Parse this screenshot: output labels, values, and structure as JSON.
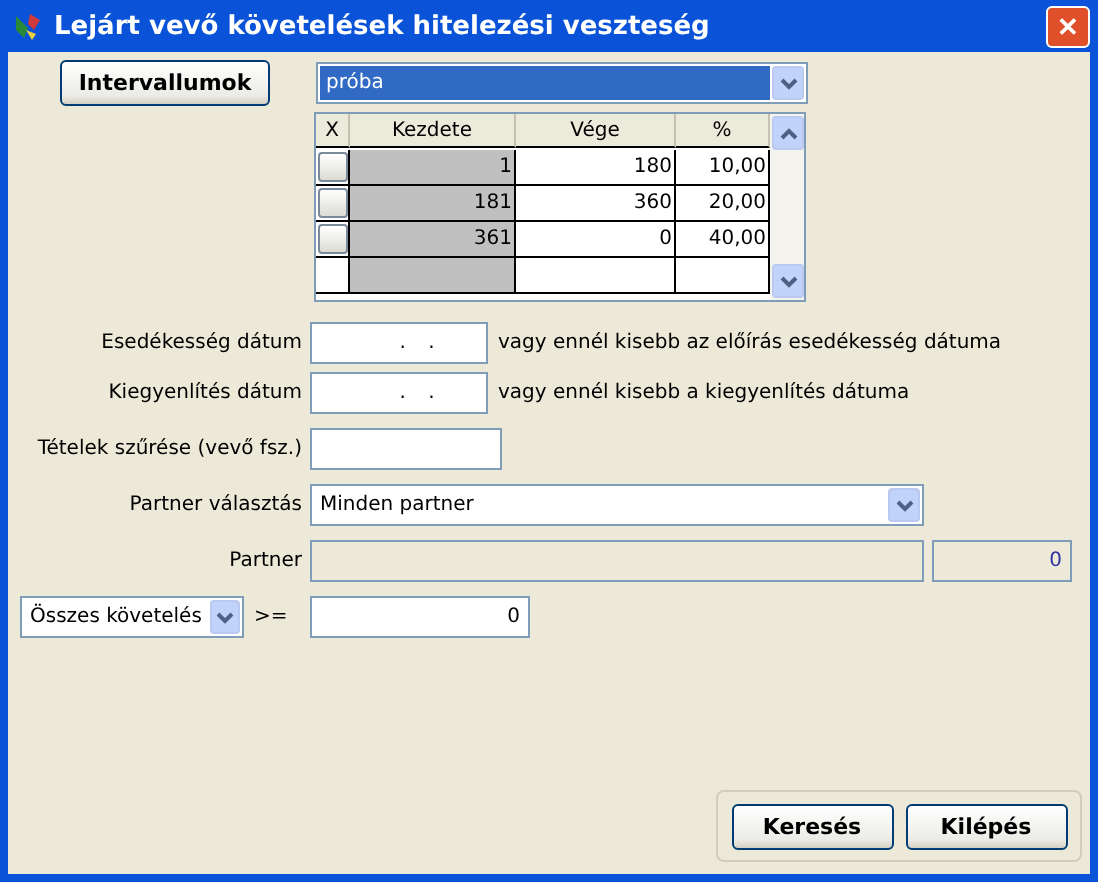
{
  "window": {
    "title": "Lejárt vevő követelések hitelezési veszteség",
    "close": "✕"
  },
  "intervals_button": "Intervallumok",
  "profile": {
    "value": "próba"
  },
  "table": {
    "columns": [
      "X",
      "Kezdete",
      "Vége",
      "%"
    ],
    "rows": [
      {
        "start": "1",
        "end": "180",
        "percent": "10,00"
      },
      {
        "start": "181",
        "end": "360",
        "percent": "20,00"
      },
      {
        "start": "361",
        "end": "0",
        "percent": "40,00"
      }
    ]
  },
  "due_date": {
    "label": "Esedékesség dátum",
    "value": ". .",
    "hint": "vagy ennél kisebb az előírás esedékesség dátuma"
  },
  "settle_date": {
    "label": "Kiegyenlítés dátum",
    "value": ". .",
    "hint": "vagy ennél kisebb a kiegyenlítés dátuma"
  },
  "filter": {
    "label": "Tételek szűrése (vevő fsz.)"
  },
  "partner_choice": {
    "label": "Partner választás",
    "value": "Minden partner"
  },
  "partner": {
    "label": "Partner",
    "code": "0"
  },
  "amount": {
    "mode": "Összes követelés",
    "operator": ">=",
    "value": "0"
  },
  "buttons": [
    "Keresés",
    "Kilépés"
  ]
}
